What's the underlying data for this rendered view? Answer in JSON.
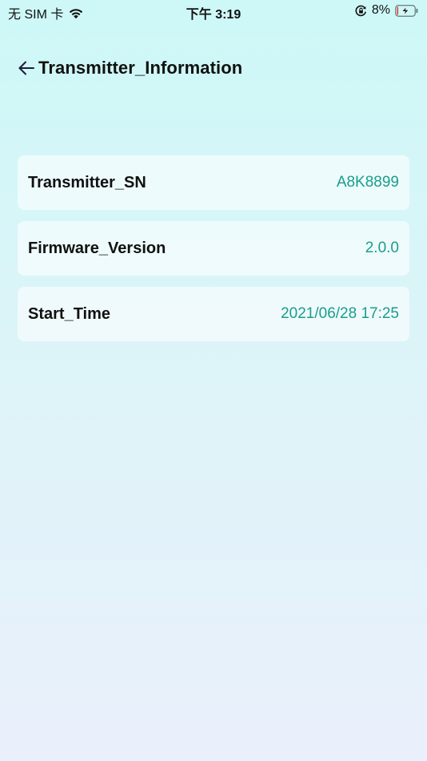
{
  "status_bar": {
    "carrier": "无 SIM 卡",
    "time": "下午 3:19",
    "battery_percent": "8%",
    "battery_level": 0.08,
    "icons": [
      "wifi-icon",
      "orientation-lock-icon",
      "battery-charging-icon"
    ]
  },
  "header": {
    "title": "Transmitter_Information",
    "back_icon": "back-arrow-icon"
  },
  "info_rows": [
    {
      "label": "Transmitter_SN",
      "value": "A8K8899"
    },
    {
      "label": "Firmware_Version",
      "value": "2.0.0"
    },
    {
      "label": "Start_Time",
      "value": "2021/06/28 17:25"
    }
  ],
  "colors": {
    "accent_value": "#1a9d8c",
    "background_top": "#cdf8f7",
    "background_bottom": "#eaf0fb",
    "battery_low": "#e8453c"
  }
}
